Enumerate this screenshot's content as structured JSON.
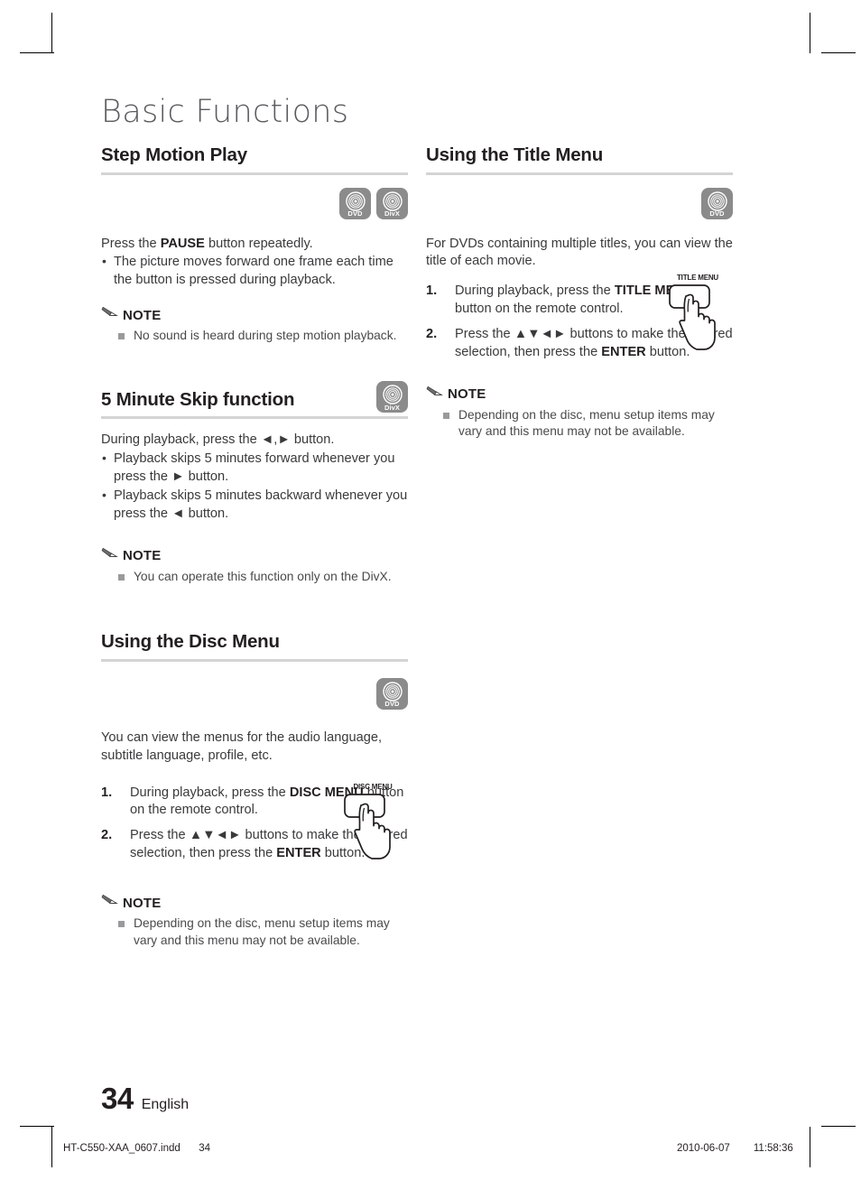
{
  "chapter": {
    "title": "Basic Functions"
  },
  "badges": {
    "dvd": "DVD",
    "divx": "DivX"
  },
  "left_column": {
    "sections": [
      {
        "heading": "Step Motion Play",
        "badges": [
          "DVD",
          "DivX"
        ],
        "lead": "Press the PAUSE button repeatedly.",
        "lead_bold": "PAUSE",
        "bullets": [
          "The picture moves forward one frame each time the button is pressed during playback."
        ],
        "note_label": "NOTE",
        "note_items": [
          "No sound is heard during step motion playback."
        ]
      },
      {
        "heading": "5 Minute Skip function",
        "badges": [
          "DivX"
        ],
        "lead": "During playback, press the ◄,► button.",
        "bullets": [
          "Playback skips 5 minutes forward whenever you press the ► button.",
          "Playback skips 5 minutes backward whenever you press the ◄ button."
        ],
        "note_label": "NOTE",
        "note_items": [
          "You can operate this function only on the DivX."
        ]
      },
      {
        "heading": "Using the Disc Menu",
        "badges": [
          "DVD"
        ],
        "lead": "You can view the menus for the audio language, subtitle language, profile, etc.",
        "steps": [
          {
            "num": "1.",
            "text_before": "During playback, press the ",
            "bold": "DISC MENU",
            "text_after": " button on the remote control."
          },
          {
            "num": "2.",
            "text_before": "Press the ▲▼◄► buttons to make the desired selection, then press the ",
            "bold": "ENTER",
            "text_after": " button."
          }
        ],
        "remote_button_caption": "DISC MENU",
        "note_label": "NOTE",
        "note_items": [
          "Depending on the disc, menu setup items may vary and this menu may not be available."
        ]
      }
    ]
  },
  "right_column": {
    "sections": [
      {
        "heading": "Using the Title Menu",
        "badges": [
          "DVD"
        ],
        "lead": "For DVDs containing multiple titles, you can view the title of each movie.",
        "steps": [
          {
            "num": "1.",
            "text_before": "During playback, press the ",
            "bold": "TITLE MENU",
            "text_after": " button on the remote control."
          },
          {
            "num": "2.",
            "text_before": "Press the ▲▼◄► buttons to make the desired selection, then press the ",
            "bold": "ENTER",
            "text_after": " button."
          }
        ],
        "remote_button_caption": "TITLE MENU",
        "note_label": "NOTE",
        "note_items": [
          "Depending on the disc, menu setup items may vary and this menu may not be available."
        ]
      }
    ]
  },
  "footer": {
    "page_number": "34",
    "language": "English",
    "slug_file": "HT-C550-XAA_0607.indd",
    "slug_page": "34",
    "slug_date": "2010-06-07",
    "slug_time": "11:58:36"
  },
  "colors": {
    "badge_gray": "#8b8b8b",
    "rule_gray": "#d4d4d4",
    "heading_black": "#231f20",
    "chapter_gray": "#5b5b5f"
  }
}
